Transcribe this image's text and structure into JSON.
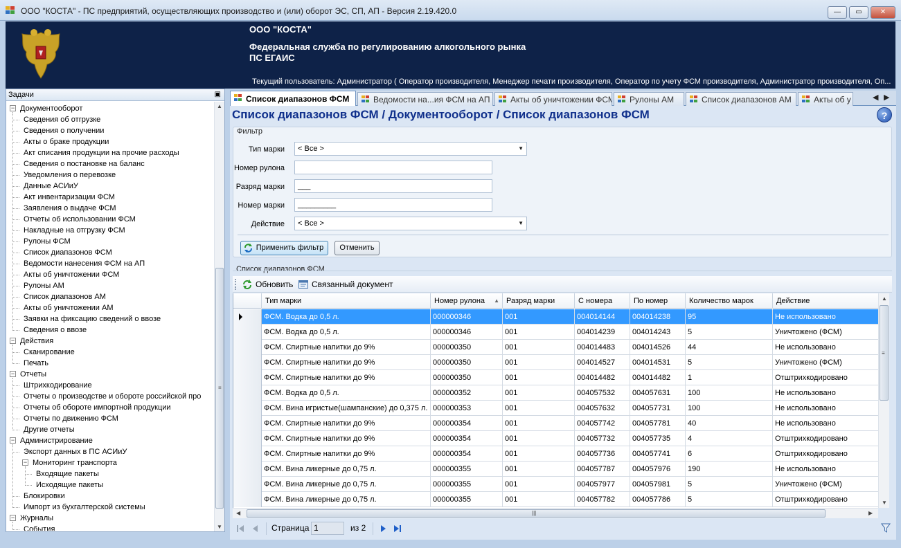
{
  "window": {
    "title": "ООО \"КОСТА\" - ПС предприятий, осуществляющих производство и (или) оборот ЭС, СП, АП - Версия 2.19.420.0",
    "minimize": "—",
    "maximize": "▭",
    "close": "✕"
  },
  "banner": {
    "org": "ООО \"КОСТА\"",
    "agency": "Федеральная служба по регулированию алкогольного рынка",
    "system": "ПС ЕГАИС",
    "current_user": "Текущий пользователь: Администратор ( Оператор производителя, Менеджер печати производителя, Оператор по учету ФСМ производителя, Администратор производителя, Оп..."
  },
  "tasks_panel": {
    "title": "Задачи",
    "pin": "ᵖ",
    "tree": [
      {
        "label": "Документооборот",
        "level": 0,
        "expander": "−"
      },
      {
        "label": "Сведения об отгрузке",
        "level": 1
      },
      {
        "label": "Сведения о получении",
        "level": 1
      },
      {
        "label": "Акты о браке продукции",
        "level": 1
      },
      {
        "label": "Акт списания продукции на прочие расходы",
        "level": 1
      },
      {
        "label": "Сведения о постановке на баланс",
        "level": 1
      },
      {
        "label": "Уведомления о перевозке",
        "level": 1
      },
      {
        "label": "Данные АСИиУ",
        "level": 1
      },
      {
        "label": "Акт инвентаризации ФСМ",
        "level": 1
      },
      {
        "label": "Заявления о выдаче ФСМ",
        "level": 1
      },
      {
        "label": "Отчеты об использовании ФСМ",
        "level": 1
      },
      {
        "label": "Накладные на отгрузку ФСМ",
        "level": 1
      },
      {
        "label": "Рулоны ФСМ",
        "level": 1
      },
      {
        "label": "Список диапазонов ФСМ",
        "level": 1
      },
      {
        "label": "Ведомости нанесения ФСМ на АП",
        "level": 1
      },
      {
        "label": "Акты об уничтожении ФСМ",
        "level": 1
      },
      {
        "label": "Рулоны АМ",
        "level": 1
      },
      {
        "label": "Список диапазонов АМ",
        "level": 1
      },
      {
        "label": "Акты об уничтожении АМ",
        "level": 1
      },
      {
        "label": "Заявки на фиксацию сведений о ввозе",
        "level": 1
      },
      {
        "label": "Сведения о ввозе",
        "level": 1
      },
      {
        "label": "Действия",
        "level": 0,
        "expander": "−"
      },
      {
        "label": "Сканирование",
        "level": 1
      },
      {
        "label": "Печать",
        "level": 1
      },
      {
        "label": "Отчеты",
        "level": 0,
        "expander": "−"
      },
      {
        "label": "Штрихкодирование",
        "level": 1
      },
      {
        "label": "Отчеты о производстве и обороте российской про",
        "level": 1
      },
      {
        "label": "Отчеты об обороте импортной продукции",
        "level": 1
      },
      {
        "label": "Отчеты по движению ФСМ",
        "level": 1
      },
      {
        "label": "Другие отчеты",
        "level": 1
      },
      {
        "label": "Администрирование",
        "level": 0,
        "expander": "−"
      },
      {
        "label": "Экспорт данных в ПС АСИиУ",
        "level": 1
      },
      {
        "label": "Мониторинг транспорта",
        "level": 1,
        "expander": "−"
      },
      {
        "label": "Входящие пакеты",
        "level": 2
      },
      {
        "label": "Исходящие пакеты",
        "level": 2
      },
      {
        "label": "Блокировки",
        "level": 1
      },
      {
        "label": "Импорт из бухгалтерской системы",
        "level": 1
      },
      {
        "label": "Журналы",
        "level": 0,
        "expander": "−"
      },
      {
        "label": "События",
        "level": 1
      }
    ]
  },
  "tabs": [
    {
      "label": "Список диапазонов ФСМ",
      "active": true
    },
    {
      "label": "Ведомости на...ия ФСМ на АП",
      "active": false
    },
    {
      "label": "Акты об уничтожении ФСМ",
      "active": false
    },
    {
      "label": "Рулоны АМ",
      "active": false
    },
    {
      "label": "Список диапазонов АМ",
      "active": false
    },
    {
      "label": "Акты об у",
      "active": false
    }
  ],
  "tab_nav": {
    "left": "◀",
    "right": "▶"
  },
  "page": {
    "title": "Список диапазонов ФСМ / Документооборот / Список диапазонов ФСМ",
    "help": "?"
  },
  "filter": {
    "legend": "Фильтр",
    "mark_type_label": "Тип марки",
    "mark_type_value": "< Все >",
    "roll_number_label": "Номер рулона",
    "roll_number_value": "",
    "mark_rank_label": "Разряд марки",
    "mark_rank_value": "___",
    "mark_number_label": "Номер марки",
    "mark_number_value": "_________",
    "action_label": "Действие",
    "action_value": "< Все >",
    "apply_label": "Применить фильтр",
    "cancel_label": "Отменить"
  },
  "list": {
    "legend": "Список диапазонов ФСМ",
    "refresh_label": "Обновить",
    "linked_label": "Связанный документ",
    "columns": [
      "Тип марки",
      "Номер рулона",
      "Разряд марки",
      "С номера",
      "По номер",
      "Количество марок",
      "Действие"
    ],
    "sort_indicator": "▲",
    "rows": [
      [
        "ФСМ. Водка до 0,5 л.",
        "000000346",
        "001",
        "004014144",
        "004014238",
        "95",
        "Не использовано"
      ],
      [
        "ФСМ. Водка до 0,5 л.",
        "000000346",
        "001",
        "004014239",
        "004014243",
        "5",
        "Уничтожено (ФСМ)"
      ],
      [
        "ФСМ. Спиртные напитки до 9%",
        "000000350",
        "001",
        "004014483",
        "004014526",
        "44",
        "Не использовано"
      ],
      [
        "ФСМ. Спиртные напитки до 9%",
        "000000350",
        "001",
        "004014527",
        "004014531",
        "5",
        "Уничтожено (ФСМ)"
      ],
      [
        "ФСМ. Спиртные напитки до 9%",
        "000000350",
        "001",
        "004014482",
        "004014482",
        "1",
        "Отштрихкодировано"
      ],
      [
        "ФСМ. Водка до 0,5 л.",
        "000000352",
        "001",
        "004057532",
        "004057631",
        "100",
        "Не использовано"
      ],
      [
        "ФСМ. Вина игристые(шампанские) до 0,375 л.",
        "000000353",
        "001",
        "004057632",
        "004057731",
        "100",
        "Не использовано"
      ],
      [
        "ФСМ. Спиртные напитки до 9%",
        "000000354",
        "001",
        "004057742",
        "004057781",
        "40",
        "Не использовано"
      ],
      [
        "ФСМ. Спиртные напитки до 9%",
        "000000354",
        "001",
        "004057732",
        "004057735",
        "4",
        "Отштрихкодировано"
      ],
      [
        "ФСМ. Спиртные напитки до 9%",
        "000000354",
        "001",
        "004057736",
        "004057741",
        "6",
        "Отштрихкодировано"
      ],
      [
        "ФСМ. Вина ликерные до 0,75 л.",
        "000000355",
        "001",
        "004057787",
        "004057976",
        "190",
        "Не использовано"
      ],
      [
        "ФСМ. Вина ликерные до 0,75 л.",
        "000000355",
        "001",
        "004057977",
        "004057981",
        "5",
        "Уничтожено (ФСМ)"
      ],
      [
        "ФСМ. Вина ликерные до 0,75 л.",
        "000000355",
        "001",
        "004057782",
        "004057786",
        "5",
        "Отштрихкодировано"
      ]
    ],
    "selected_row": 0
  },
  "pager": {
    "page_label": "Страница",
    "page_value": "1",
    "of_label": "из",
    "total_pages": "2"
  },
  "colors": {
    "banner_bg": "#0e2248",
    "title_blue": "#10308c",
    "selection": "#3399ff",
    "content_bg": "#dbe6f4"
  }
}
